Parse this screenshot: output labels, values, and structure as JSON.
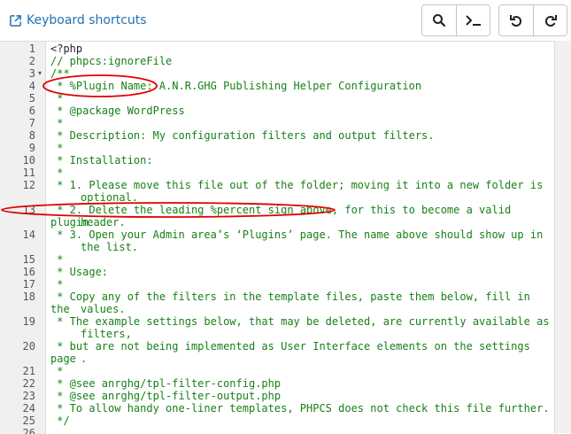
{
  "toolbar": {
    "keyboard_shortcuts_label": "Keyboard shortcuts",
    "icons": [
      "external-link-icon",
      "search-icon",
      "terminal-icon",
      "undo-icon",
      "redo-icon"
    ]
  },
  "colors": {
    "accent": "#2271b1",
    "comment": "#188018",
    "gutter_bg": "#f0f0f1",
    "annotation": "#e00000"
  },
  "editor": {
    "lines": [
      {
        "num": "1",
        "text": "<?php",
        "cont": ""
      },
      {
        "num": "2",
        "text": "// phpcs:ignoreFile",
        "cont": ""
      },
      {
        "num": "3",
        "text": "/**",
        "cont": "",
        "fold": "▾"
      },
      {
        "num": "4",
        "text": " * %Plugin Name: A.N.R.GHG Publishing Helper Configuration",
        "cont": ""
      },
      {
        "num": "5",
        "text": " *",
        "cont": ""
      },
      {
        "num": "6",
        "text": " * @package WordPress",
        "cont": ""
      },
      {
        "num": "7",
        "text": " *",
        "cont": ""
      },
      {
        "num": "8",
        "text": " * Description: My configuration filters and output filters.",
        "cont": ""
      },
      {
        "num": "9",
        "text": " *",
        "cont": ""
      },
      {
        "num": "10",
        "text": " * Installation:",
        "cont": ""
      },
      {
        "num": "11",
        "text": " *",
        "cont": ""
      },
      {
        "num": "12",
        "text": " * 1. Please move this file out of the folder; moving it into a new folder is",
        "cont": "optional."
      },
      {
        "num": "13",
        "text": " * 2. Delete the leading %percent sign above, for this to become a valid plugin",
        "cont": "header."
      },
      {
        "num": "14",
        "text": " * 3. Open your Admin area’s ‘Plugins’ page. The name above should show up in",
        "cont": "the list."
      },
      {
        "num": "15",
        "text": " *",
        "cont": ""
      },
      {
        "num": "16",
        "text": " * Usage:",
        "cont": ""
      },
      {
        "num": "17",
        "text": " *",
        "cont": ""
      },
      {
        "num": "18",
        "text": " * Copy any of the filters in the template files, paste them below, fill in the",
        "cont": "values."
      },
      {
        "num": "19",
        "text": " * The example settings below, that may be deleted, are currently available as",
        "cont": "filters,"
      },
      {
        "num": "20",
        "text": " * but are not being implemented as User Interface elements on the settings page",
        "cont": "."
      },
      {
        "num": "21",
        "text": " *",
        "cont": ""
      },
      {
        "num": "22",
        "text": " * @see anrghg/tpl-filter-config.php",
        "cont": ""
      },
      {
        "num": "23",
        "text": " * @see anrghg/tpl-filter-output.php",
        "cont": ""
      },
      {
        "num": "24",
        "text": " * To allow handy one-liner templates, PHPCS does not check this file further.",
        "cont": ""
      },
      {
        "num": "25",
        "text": " */",
        "cont": ""
      },
      {
        "num": "26",
        "text": "",
        "cont": ""
      }
    ]
  }
}
